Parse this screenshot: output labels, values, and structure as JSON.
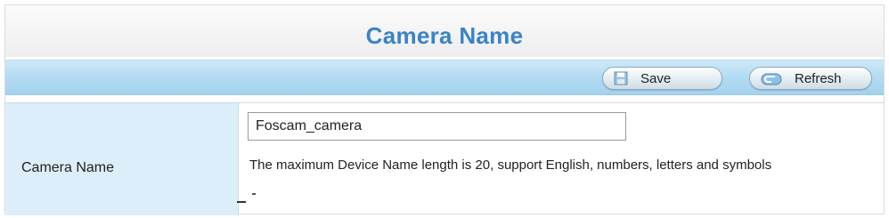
{
  "header": {
    "title": "Camera Name"
  },
  "toolbar": {
    "save": {
      "label": "Save",
      "icon": "save-icon"
    },
    "refresh": {
      "label": "Refresh",
      "icon": "refresh-icon"
    }
  },
  "form": {
    "camera_name": {
      "label": "Camera Name",
      "value": "Foscam_camera",
      "hint": "The maximum Device Name length is 20, support English, numbers, letters and symbols"
    }
  },
  "colors": {
    "title": "#3a83c7",
    "toolbar": "#b4dcf3",
    "label_cell": "#dceefa"
  }
}
